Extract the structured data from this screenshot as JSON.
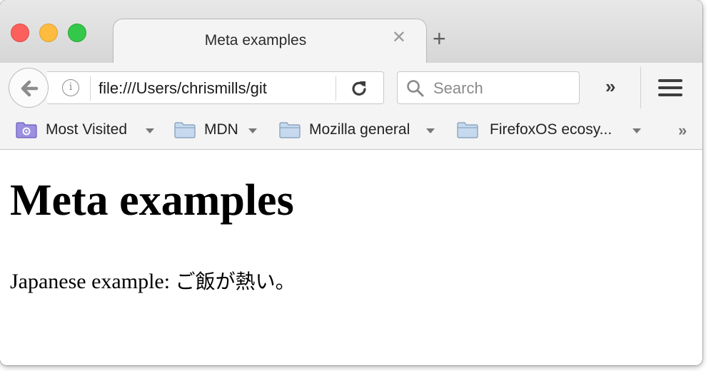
{
  "window": {
    "controls": [
      "close",
      "minimize",
      "zoom"
    ],
    "tab": {
      "title": "Meta examples",
      "close_glyph": "✕",
      "new_tab_glyph": "+"
    }
  },
  "navbar": {
    "back_icon": "back-arrow-icon",
    "url": "file:///Users/chrismills/git",
    "reload_icon": "reload-icon",
    "search_placeholder": "Search",
    "overflow_glyph": "»",
    "menu_icon": "hamburger-menu-icon"
  },
  "bookmarks": {
    "items": [
      {
        "label": "Most Visited",
        "icon": "most-visited-icon"
      },
      {
        "label": "MDN",
        "icon": "folder-icon"
      },
      {
        "label": "Mozilla general",
        "icon": "folder-icon"
      },
      {
        "label": "FirefoxOS ecosy...",
        "icon": "folder-icon"
      }
    ],
    "overflow_glyph": "»"
  },
  "page": {
    "heading": "Meta examples",
    "paragraph_prefix": "Japanese example: ",
    "paragraph_japanese": "ご飯が熱い。"
  },
  "colors": {
    "close": "#fc605c",
    "minimize": "#fdbc40",
    "zoom": "#34c84a",
    "chrome": "#f4f4f4"
  }
}
